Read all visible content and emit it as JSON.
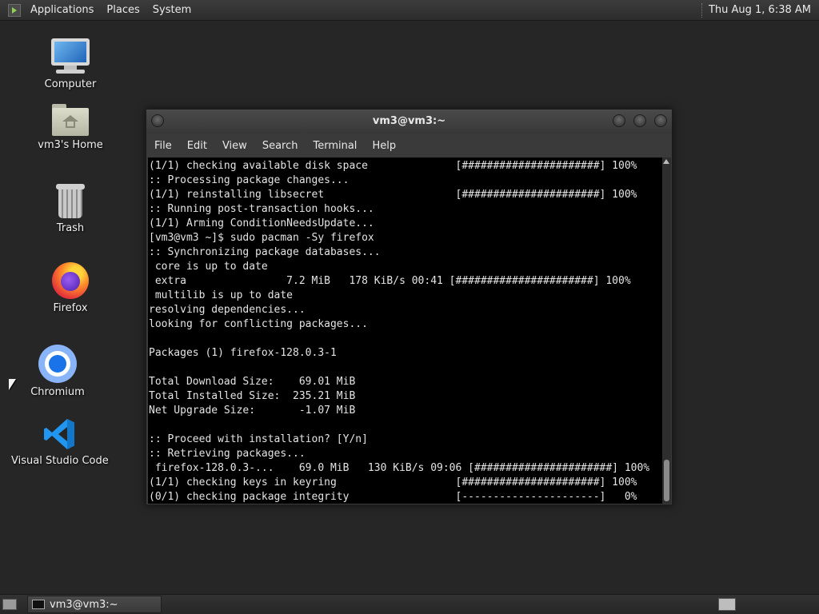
{
  "top_panel": {
    "menus": [
      "Applications",
      "Places",
      "System"
    ],
    "clock": "Thu Aug  1,  6:38 AM"
  },
  "desktop_icons": [
    {
      "label": "Computer",
      "icon": "computer-icon"
    },
    {
      "label": "vm3's Home",
      "icon": "home-folder-icon"
    },
    {
      "label": "Trash",
      "icon": "trash-icon"
    },
    {
      "label": "Firefox",
      "icon": "firefox-icon"
    },
    {
      "label": "Chromium",
      "icon": "chromium-icon"
    },
    {
      "label": "Visual Studio Code",
      "icon": "vscode-icon"
    }
  ],
  "terminal": {
    "title": "vm3@vm3:~",
    "menu": [
      "File",
      "Edit",
      "View",
      "Search",
      "Terminal",
      "Help"
    ],
    "lines": [
      "(1/1) checking available disk space              [######################] 100%",
      ":: Processing package changes...",
      "(1/1) reinstalling libsecret                     [######################] 100%",
      ":: Running post-transaction hooks...",
      "(1/1) Arming ConditionNeedsUpdate...",
      "[vm3@vm3 ~]$ sudo pacman -Sy firefox",
      ":: Synchronizing package databases...",
      " core is up to date",
      " extra                7.2 MiB   178 KiB/s 00:41 [######################] 100%",
      " multilib is up to date",
      "resolving dependencies...",
      "looking for conflicting packages...",
      "",
      "Packages (1) firefox-128.0.3-1",
      "",
      "Total Download Size:    69.01 MiB",
      "Total Installed Size:  235.21 MiB",
      "Net Upgrade Size:       -1.07 MiB",
      "",
      ":: Proceed with installation? [Y/n]",
      ":: Retrieving packages...",
      " firefox-128.0.3-...    69.0 MiB   130 KiB/s 09:06 [######################] 100%",
      "(1/1) checking keys in keyring                   [######################] 100%",
      "(0/1) checking package integrity                 [----------------------]   0%"
    ]
  },
  "bottom_panel": {
    "task_label": "vm3@vm3:~"
  }
}
